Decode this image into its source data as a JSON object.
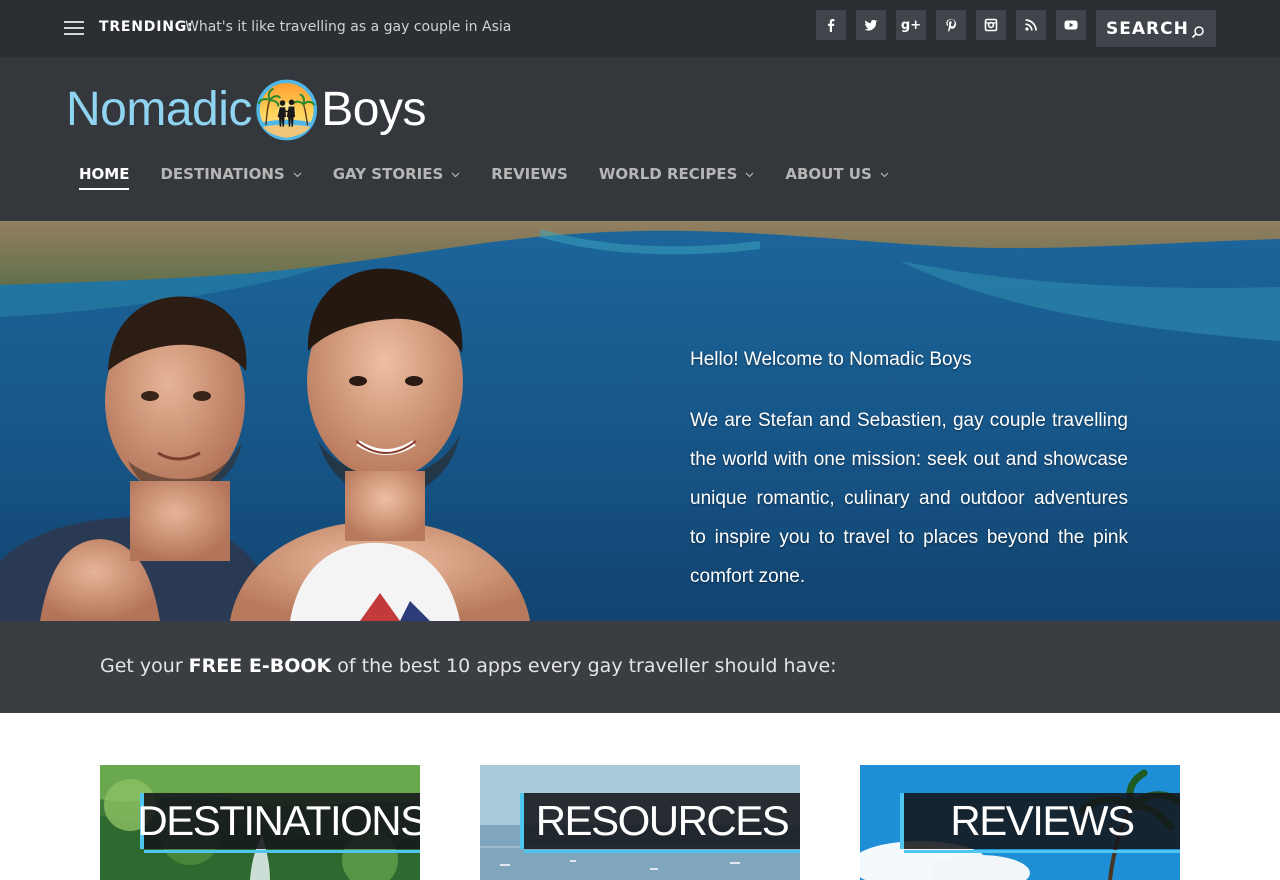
{
  "topbar": {
    "trending_label": "TRENDING:",
    "trending_link": "What's it like travelling as a gay couple in Asia",
    "social_icons": [
      "facebook-icon",
      "twitter-icon",
      "google-plus-icon",
      "pinterest-icon",
      "instagram-icon",
      "rss-icon",
      "youtube-icon"
    ],
    "google_plus_glyph": "g+",
    "search_placeholder": "SEARCH"
  },
  "logo": {
    "word1": "Nomadic",
    "word2": "Boys",
    "colors": {
      "word1": "#8fd4f0",
      "word2": "#ffffff",
      "badge_ring": "#4fb8e8"
    }
  },
  "nav": {
    "items": [
      {
        "label": "HOME",
        "active": true,
        "has_dropdown": false
      },
      {
        "label": "DESTINATIONS",
        "active": false,
        "has_dropdown": true
      },
      {
        "label": "GAY STORIES",
        "active": false,
        "has_dropdown": true
      },
      {
        "label": "REVIEWS",
        "active": false,
        "has_dropdown": false
      },
      {
        "label": "WORLD RECIPES",
        "active": false,
        "has_dropdown": true
      },
      {
        "label": "ABOUT US",
        "active": false,
        "has_dropdown": true
      }
    ]
  },
  "hero": {
    "greeting": "Hello! Welcome to Nomadic Boys",
    "description": "We are Stefan and Sebastien, gay couple travelling the world with one mission: seek out and showcase unique romantic, culinary and outdoor adventures to inspire you to travel to places beyond the pink comfort zone."
  },
  "ebook": {
    "prefix": "Get your ",
    "highlight": "FREE E-BOOK",
    "suffix": " of the best 10 apps every gay traveller should have:"
  },
  "cards": [
    {
      "label": "DESTINATIONS"
    },
    {
      "label": "RESOURCES"
    },
    {
      "label": "REVIEWS"
    }
  ],
  "colors": {
    "topbar_bg": "#2b2f34",
    "header_bg": "#34383d",
    "ebook_bg": "#3a3e43",
    "accent": "#4fc6ef",
    "nav_inactive": "#b6b6b6",
    "nav_active": "#ffffff"
  }
}
